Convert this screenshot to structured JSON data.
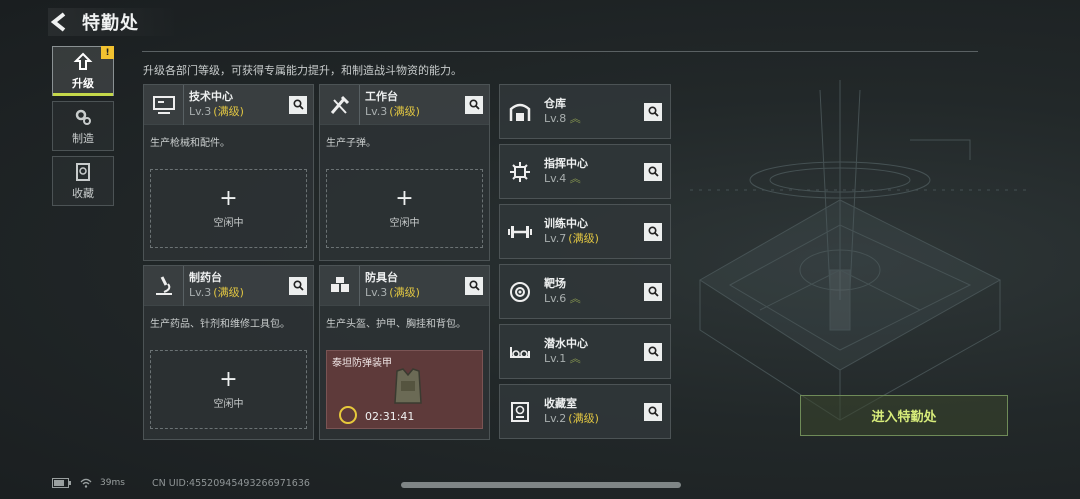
{
  "header": {
    "title": "特勤处"
  },
  "description": "升级各部门等级，可获得专属能力提升，和制造战斗物资的能力。",
  "tabs": [
    {
      "label": "升级",
      "active": true,
      "badge": "!"
    },
    {
      "label": "制造",
      "active": false
    },
    {
      "label": "收藏",
      "active": false
    }
  ],
  "big_cards": [
    {
      "name": "技术中心",
      "level": "Lv.3",
      "max": "(满级)",
      "desc": "生产枪械和配件。",
      "slot_plus": "+",
      "slot_text": "空闲中"
    },
    {
      "name": "工作台",
      "level": "Lv.3",
      "max": "(满级)",
      "desc": "生产子弹。",
      "slot_plus": "+",
      "slot_text": "空闲中"
    },
    {
      "name": "制药台",
      "level": "Lv.3",
      "max": "(满级)",
      "desc": "生产药品、针剂和维修工具包。",
      "slot_plus": "+",
      "slot_text": "空闲中"
    },
    {
      "name": "防具台",
      "level": "Lv.3",
      "max": "(满级)",
      "desc": "生产头盔、护甲、胸挂和背包。",
      "craft_item": "泰坦防弹装甲",
      "craft_time": "02:31:41"
    }
  ],
  "small_cards": [
    {
      "name": "仓库",
      "level": "Lv.8",
      "max": "",
      "upgrade_icon": "chevron-up-icon"
    },
    {
      "name": "指挥中心",
      "level": "Lv.4",
      "max": "",
      "upgrade_icon": "chevron-up-icon"
    },
    {
      "name": "训练中心",
      "level": "Lv.7",
      "max": "(满级)"
    },
    {
      "name": "靶场",
      "level": "Lv.6",
      "max": "",
      "upgrade_icon": "chevron-up-icon"
    },
    {
      "name": "潜水中心",
      "level": "Lv.1",
      "max": "",
      "upgrade_icon": "chevron-up-icon"
    },
    {
      "name": "收藏室",
      "level": "Lv.2",
      "max": "(满级)"
    }
  ],
  "enter_button": "进入特勤处",
  "status": {
    "ping": "39ms",
    "uid": "CN UID:455209454932669716­36"
  },
  "colors": {
    "accent": "#c5d84a",
    "max_level": "#e0c542",
    "enter_text": "#d7ec7a",
    "craft_bg": "#5e3a3a"
  }
}
